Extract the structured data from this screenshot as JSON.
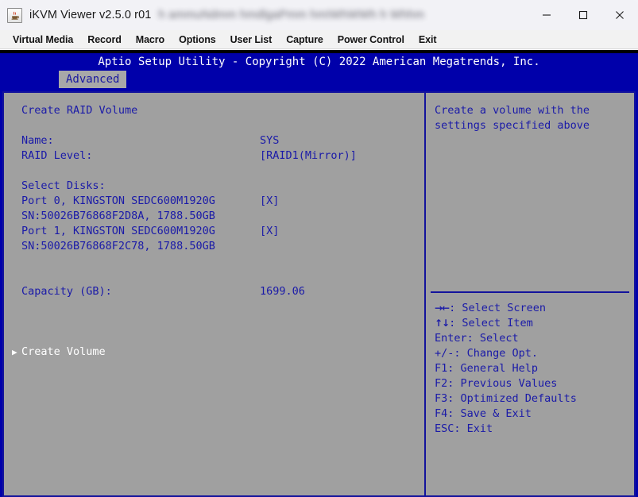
{
  "window": {
    "title": "iKVM Viewer v2.5.0 r01",
    "redacted_title_suffix": "h ammuNdmm hmdlgaPmm hmIWhWWh h Whhm",
    "app_icon": "java-coffee-cup-icon",
    "controls": {
      "minimize": "minimize-icon",
      "maximize": "maximize-icon",
      "close": "close-icon"
    }
  },
  "menu": {
    "items": [
      {
        "label": "Virtual Media"
      },
      {
        "label": "Record"
      },
      {
        "label": "Macro"
      },
      {
        "label": "Options"
      },
      {
        "label": "User List"
      },
      {
        "label": "Capture"
      },
      {
        "label": "Power Control"
      },
      {
        "label": "Exit"
      }
    ]
  },
  "bios": {
    "header": "Aptio Setup Utility - Copyright (C) 2022 American Megatrends, Inc.",
    "active_tab": "Advanced",
    "colors": {
      "screen_blue": "#0000aa",
      "panel_gray": "#a0a0a0",
      "text_blue": "#1a1aa8",
      "selected_white": "#ffffff",
      "tab_gray": "#a8a8a8"
    },
    "left": {
      "section_title": "Create RAID Volume",
      "fields": [
        {
          "label": "Name:",
          "value": "SYS"
        },
        {
          "label": "RAID Level:",
          "value": "[RAID1(Mirror)]"
        }
      ],
      "disks_header": "Select Disks:",
      "disks": [
        {
          "port_line": "Port 0, KINGSTON SEDC600M1920G",
          "selected_marker": "[X]",
          "detail_line": "SN:50026B76868F2D8A, 1788.50GB"
        },
        {
          "port_line": "Port 1, KINGSTON SEDC600M1920G",
          "selected_marker": "[X]",
          "detail_line": "SN:50026B76868F2C78, 1788.50GB"
        }
      ],
      "capacity": {
        "label": "Capacity (GB):",
        "value": "1699.06"
      },
      "action": {
        "label": "Create Volume",
        "arrow": "right-triangle-icon",
        "selected": true
      }
    },
    "right": {
      "help_lines": [
        "Create a volume with the",
        "settings specified above"
      ],
      "legend": [
        {
          "key": "→←",
          "key_is_glyph": true,
          "text": ": Select Screen"
        },
        {
          "key": "↑↓",
          "key_is_glyph": true,
          "text": ": Select Item"
        },
        {
          "key": "Enter",
          "key_is_glyph": false,
          "text": ": Select"
        },
        {
          "key": "+/-",
          "key_is_glyph": false,
          "text": ": Change Opt."
        },
        {
          "key": "F1",
          "key_is_glyph": false,
          "text": ": General Help"
        },
        {
          "key": "F2",
          "key_is_glyph": false,
          "text": ": Previous Values"
        },
        {
          "key": "F3",
          "key_is_glyph": false,
          "text": ": Optimized Defaults"
        },
        {
          "key": "F4",
          "key_is_glyph": false,
          "text": ": Save & Exit"
        },
        {
          "key": "ESC",
          "key_is_glyph": false,
          "text": ": Exit"
        }
      ]
    }
  }
}
